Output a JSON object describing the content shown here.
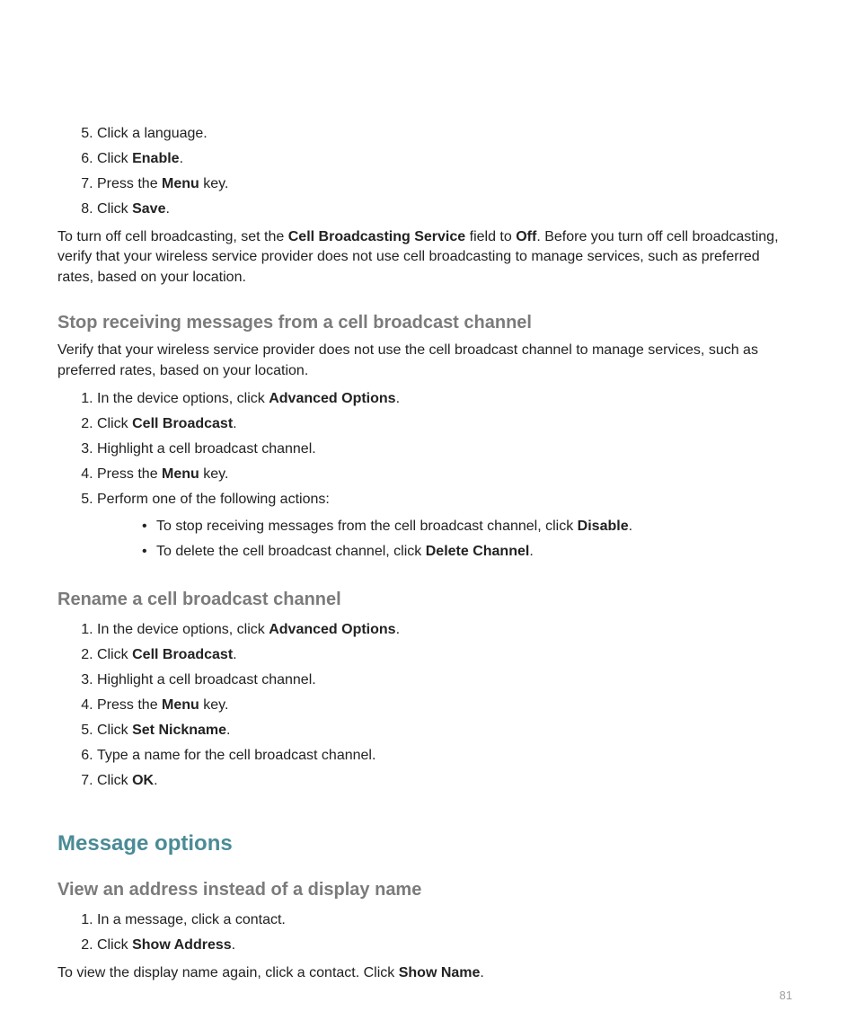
{
  "pageNumber": "81",
  "intro": {
    "list": [
      {
        "html": "Click a language."
      },
      {
        "html": "Click <b>Enable</b>."
      },
      {
        "html": "Press the <b>Menu</b> key."
      },
      {
        "html": "Click <b>Save</b>."
      }
    ],
    "listStart": "5",
    "paragraph": "To turn off cell broadcasting, set the <b>Cell Broadcasting Service</b> field to <b>Off</b>. Before you turn off cell broadcasting, verify that your wireless service provider does not use cell broadcasting to manage services, such as preferred rates, based on your location."
  },
  "stop": {
    "heading": "Stop receiving messages from a cell broadcast channel",
    "paragraph": "Verify that your wireless service provider does not use the cell broadcast channel to manage services, such as preferred rates, based on your location.",
    "list": [
      {
        "html": "In the device options, click <b>Advanced Options</b>."
      },
      {
        "html": "Click <b>Cell Broadcast</b>."
      },
      {
        "html": "Highlight a cell broadcast channel."
      },
      {
        "html": "Press the <b>Menu</b> key."
      },
      {
        "html": "Perform one of the following actions:"
      }
    ],
    "sublist": [
      {
        "html": "To stop receiving messages from the cell broadcast channel, click <b>Disable</b>."
      },
      {
        "html": "To delete the cell broadcast channel, click <b>Delete Channel</b>."
      }
    ]
  },
  "rename": {
    "heading": "Rename a cell broadcast channel",
    "list": [
      {
        "html": "In the device options, click <b>Advanced Options</b>."
      },
      {
        "html": "Click <b>Cell Broadcast</b>."
      },
      {
        "html": "Highlight a cell broadcast channel."
      },
      {
        "html": "Press the <b>Menu</b> key."
      },
      {
        "html": "Click <b>Set Nickname</b>."
      },
      {
        "html": "Type a name for the cell broadcast channel."
      },
      {
        "html": "Click <b>OK</b>."
      }
    ]
  },
  "msgOptions": {
    "heading": "Message options"
  },
  "viewAddress": {
    "heading": "View an address instead of a display name",
    "list": [
      {
        "html": "In a message, click a contact."
      },
      {
        "html": "Click <b>Show Address</b>."
      }
    ],
    "paragraph": "To view the display name again, click a contact. Click <b>Show Name</b>."
  }
}
